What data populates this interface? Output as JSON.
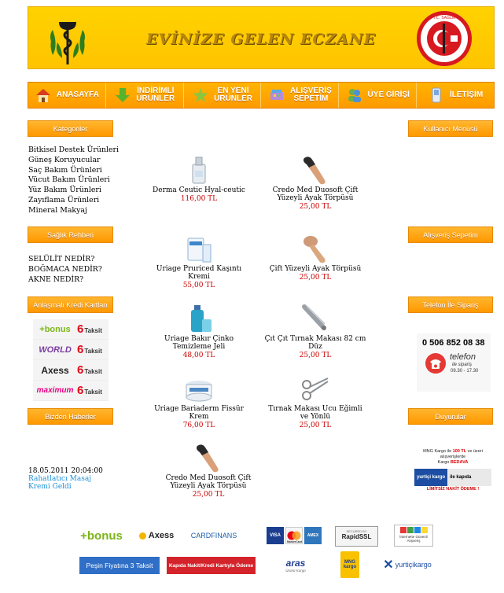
{
  "header": {
    "title": "EVİNİZE GELEN ECZANE",
    "seal_text": "T.C. SAĞLIK BAKANLIĞI · THE MINISTRY OF HEALTH OF TURKEY"
  },
  "nav": [
    {
      "label": "ANASAYFA",
      "icon": "home-icon"
    },
    {
      "label": "İNDİRİMLİ\nÜRÜNLER",
      "icon": "down-arrow-icon"
    },
    {
      "label": "EN YENİ\nÜRÜNLER",
      "icon": "star-icon"
    },
    {
      "label": "ALIŞVERİŞ\nSEPETİM",
      "icon": "basket-icon"
    },
    {
      "label": "ÜYE GİRİŞİ",
      "icon": "users-icon"
    },
    {
      "label": "İLETİŞİM",
      "icon": "phone-icon"
    }
  ],
  "left": {
    "categories_title": "Kategoriler",
    "categories": [
      "Bitkisel Destek Ürünleri",
      "Güneş Koruyucular",
      "Saç Bakım Ürünleri",
      "Vücut Bakım Ürünleri",
      "Yüz Bakım Ürünleri",
      "Zayıflama Ürünleri",
      "Mineral Makyaj"
    ],
    "guide_title": "Sağlık Rehberi",
    "guide": [
      "SELÜLİT NEDİR?",
      "BOĞMACA NEDİR?",
      "AKNE NEDİR?"
    ],
    "cards_title": "Anlaşmalı Kredi Kartları",
    "cards": [
      {
        "name": "+bonus",
        "taksit_num": "6",
        "taksit_label": "Taksit",
        "color": "#7cb518"
      },
      {
        "name": "WORLD",
        "taksit_num": "6",
        "taksit_label": "Taksit",
        "color": "#7b3fa0"
      },
      {
        "name": "Axess",
        "taksit_num": "6",
        "taksit_label": "Taksit",
        "color": "#d4a300"
      },
      {
        "name": "maximum",
        "taksit_num": "6",
        "taksit_label": "Taksit",
        "color": "#e5007e"
      }
    ],
    "news_title": "Bizden Haberler",
    "news_date": "18.05.2011 20:04:00",
    "news_link": "Rahatlatıcı Masaj Kremi Geldi"
  },
  "right": {
    "user_menu_title": "Kullanıcı Menüsü",
    "cart_title": "Alışveriş Sepetim",
    "phone_title": "Telefon İle Sipariş",
    "phone_number": "0 506 852 08 38",
    "phone_word": "telefon",
    "phone_sub": "ile sipariş",
    "phone_hours": "09.30 - 17.30",
    "announce_title": "Duyurular",
    "announce_line1_a": "MNG Kargo ile ",
    "announce_line1_b": "100 TL",
    "announce_line1_c": " ve üzeri",
    "announce_line2": "alışverişlerde",
    "announce_line3_a": "Kargo ",
    "announce_line3_b": "BEDAVA",
    "announce_yurtici": "yurtiçi kargo",
    "announce_kapida": "ile kapıda",
    "announce_limitsiz": "LİMİTSİZ NAKİT ÖDEME !"
  },
  "products": [
    {
      "name": "Derma Ceutic Hyal-ceutic",
      "price": "116,00 TL",
      "icon": "serum-bottle-icon"
    },
    {
      "name": "Credo Med Duosoft Çift Yüzeyli Ayak Törpüsü",
      "price": "25,00 TL",
      "icon": "foot-file-icon"
    },
    {
      "name": "Uriage Pruriced Kaşıntı Kremi",
      "price": "55,00 TL",
      "icon": "cream-tube-icon"
    },
    {
      "name": "Çift Yüzeyli Ayak Törpüsü",
      "price": "25,00 TL",
      "icon": "foot-file-icon"
    },
    {
      "name": "Uriage Bakır Çinko Temizleme Jeli",
      "price": "48,00 TL",
      "icon": "gel-bottle-icon"
    },
    {
      "name": "Çıt Çıt Tırnak Makası 82 cm Düz",
      "price": "25,00 TL",
      "icon": "nail-clipper-icon"
    },
    {
      "name": "Uriage Bariaderm Fissür Krem",
      "price": "76,00 TL",
      "icon": "cream-jar-icon"
    },
    {
      "name": "Tırnak Makası Ucu Eğimli ve Yönlü",
      "price": "25,00 TL",
      "icon": "scissors-icon"
    },
    {
      "name": "Credo Med Duosoft Çift Yüzeyli Ayak Törpüsü",
      "price": "25,00 TL",
      "icon": "foot-file-icon"
    }
  ],
  "footer": {
    "banks": [
      "+bonus",
      "Axess",
      "CARDFINANS"
    ],
    "payment": [
      "VISA",
      "MasterCard",
      "AMEX"
    ],
    "ssl": "RapidSSL",
    "ssl_top": "SECURED BY",
    "safe": "İnternette Güvenli Alışveriş",
    "buttons": [
      "Peşin Fiyatına 3 Taksit",
      "Kapıda Nakit/Kredi Kartıyla Ödeme"
    ],
    "cargo": [
      "aras",
      "MNG kargo",
      "yurtiçikargo"
    ],
    "aras_sub": "Ürünü Kargo"
  }
}
